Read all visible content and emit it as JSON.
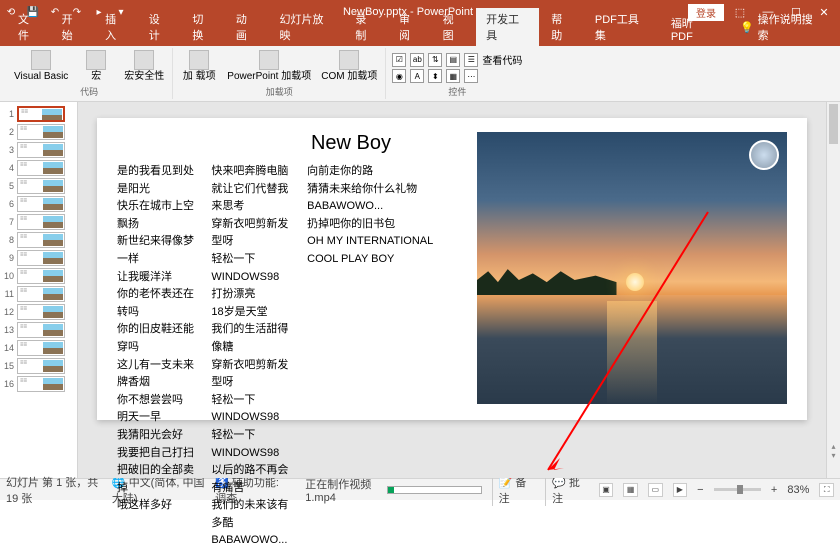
{
  "titlebar": {
    "title": "NewBoy.pptx - PowerPoint",
    "login": "登录"
  },
  "tabs": [
    "文件",
    "开始",
    "插入",
    "设计",
    "切换",
    "动画",
    "幻灯片放映",
    "录制",
    "审阅",
    "视图",
    "开发工具",
    "帮助",
    "PDF工具集",
    "福昕PDF"
  ],
  "active_tab": 10,
  "help_hint": "操作说明搜索",
  "ribbon": {
    "code": {
      "vb": "Visual Basic",
      "macro": "宏",
      "security": "宏安全性",
      "label": "代码"
    },
    "addins": {
      "addin": "加\n载项",
      "ppt": "PowerPoint\n加载项",
      "com": "COM 加载项",
      "label": "加载项"
    },
    "controls": {
      "view_code": "查看代码",
      "label": "控件"
    }
  },
  "slide": {
    "title": "New Boy",
    "col1": "是的我看见到处是阳光\n快乐在城市上空飘扬\n新世纪来得像梦一样\n让我暖洋洋\n你的老怀表还在转吗\n你的旧皮鞋还能穿吗\n这儿有一支未来牌香烟\n你不想尝尝吗\n明天一早\n我猜阳光会好\n我要把自己打扫\n把破旧的全部卖掉\n哦这样多好",
    "col2": "快来吧奔腾电脑\n就让它们代替我来思考\n穿新衣吧剪新发型呀\n轻松一下WINDOWS98\n打扮漂亮\n18岁是天堂\n我们的生活甜得像糖\n穿新衣吧剪新发型呀\n轻松一下WINDOWS98\n轻松一下WINDOWS98\n以后的路不再会有痛苦\n我们的未来该有多酷\nBABAWOWO...",
    "col3": "向前走你的路\n猜猜未来给你什么礼物\nBABAWOWO...\n扔掉吧你的旧书包\nOH MY INTERNATIONAL COOL PLAY BOY"
  },
  "thumbs_count": 16,
  "status": {
    "slide_info": "幻灯片 第 1 张，共 19 张",
    "lang": "中文(简体, 中国大陆)",
    "access": "辅助功能: 调查",
    "video": "正在制作视频 1.mp4",
    "notes": "备注",
    "comments": "批注",
    "zoom": "83%"
  }
}
